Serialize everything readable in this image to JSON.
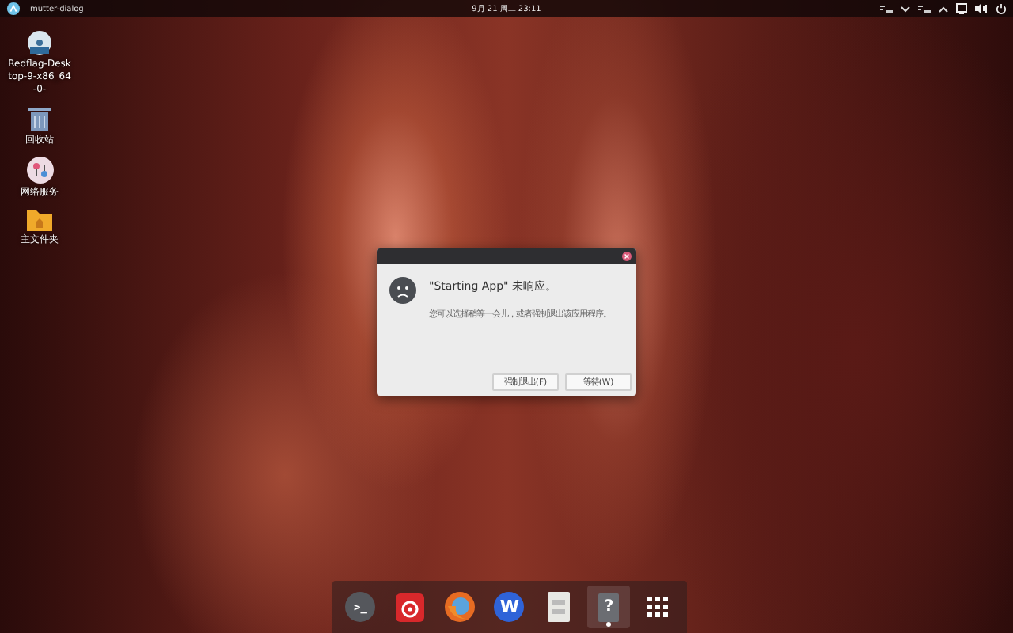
{
  "top_bar": {
    "window_title": "mutter-dialog",
    "clock": "9月 21 周二 23:11"
  },
  "desktop_icons": [
    {
      "kind": "disc",
      "label": "Redflag-Desktop-9-x86_64-0-"
    },
    {
      "kind": "trash",
      "label": "回收站"
    },
    {
      "kind": "network",
      "label": "网络服务"
    },
    {
      "kind": "folder",
      "label": "主文件夹"
    }
  ],
  "dialog": {
    "title": "\"Starting App\" 未响应。",
    "message": "您可以选择稍等一会儿，或者强制退出该应用程序。",
    "buttons": [
      "强制退出(F)",
      "等待(W)"
    ]
  },
  "dock": [
    {
      "kind": "terminal",
      "glyph": ">_",
      "active": false
    },
    {
      "kind": "music",
      "active": false
    },
    {
      "kind": "browser",
      "active": false
    },
    {
      "kind": "writer",
      "glyph": "W",
      "active": false
    },
    {
      "kind": "files",
      "active": false
    },
    {
      "kind": "unknown",
      "glyph": "?",
      "active": true
    },
    {
      "kind": "apps",
      "active": false
    }
  ]
}
